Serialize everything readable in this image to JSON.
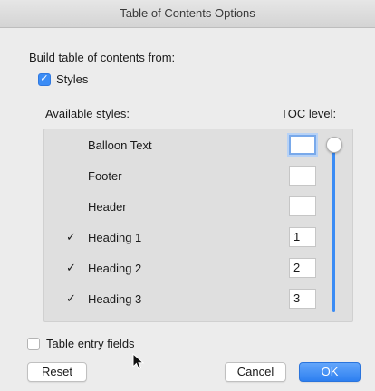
{
  "window": {
    "title": "Table of Contents Options"
  },
  "build_from": {
    "label": "Build table of contents from:",
    "styles_checkbox": {
      "label": "Styles",
      "checked": true
    }
  },
  "available_styles_label": "Available styles:",
  "toc_level_label": "TOC level:",
  "styles": [
    {
      "name": "Balloon Text",
      "checked": false,
      "check_mark": "",
      "level": ""
    },
    {
      "name": "Footer",
      "checked": false,
      "check_mark": "",
      "level": ""
    },
    {
      "name": "Header",
      "checked": false,
      "check_mark": "",
      "level": ""
    },
    {
      "name": "Heading 1",
      "checked": true,
      "check_mark": "✓",
      "level": "1"
    },
    {
      "name": "Heading 2",
      "checked": true,
      "check_mark": "✓",
      "level": "2"
    },
    {
      "name": "Heading 3",
      "checked": true,
      "check_mark": "✓",
      "level": "3"
    }
  ],
  "table_entry_fields": {
    "label": "Table entry fields",
    "checked": false
  },
  "buttons": {
    "reset": "Reset",
    "cancel": "Cancel",
    "ok": "OK"
  },
  "colors": {
    "accent": "#3b8cf5"
  }
}
